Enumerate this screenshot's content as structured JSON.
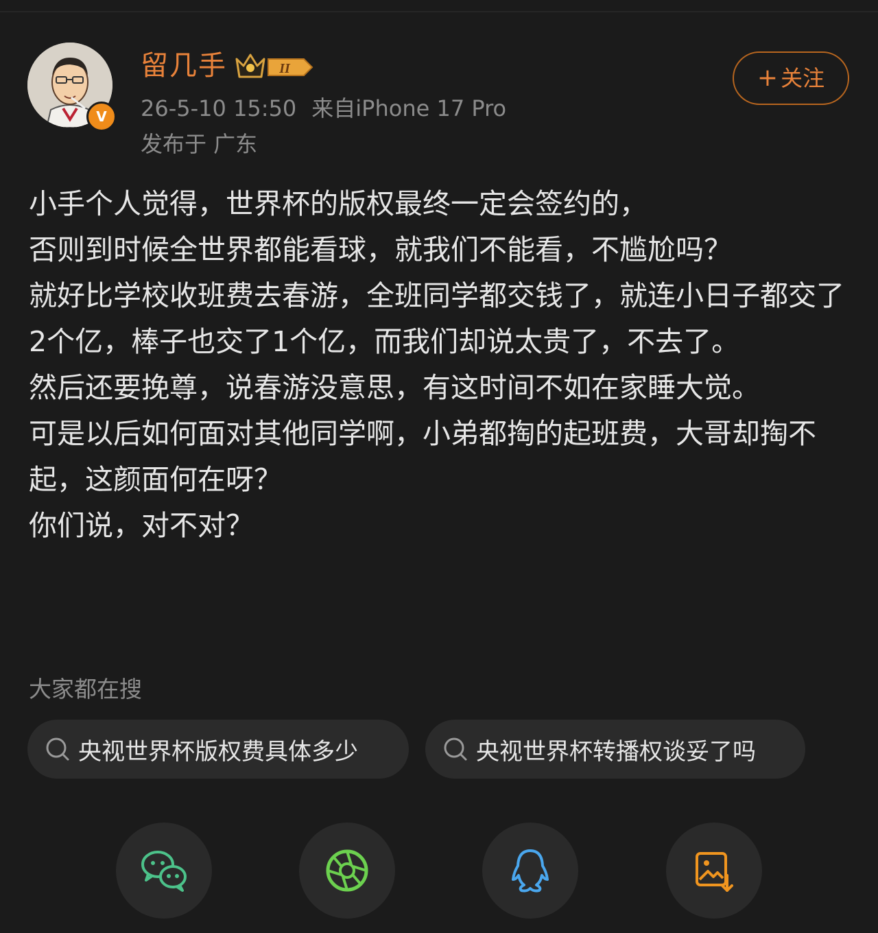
{
  "header": {
    "username": "留几手",
    "level_badge_text": "II",
    "verified_badge": "V",
    "timestamp": "26-5-10 15:50",
    "source": "来自iPhone 17 Pro",
    "location": "发布于 广东",
    "follow_label": "关注",
    "follow_icon": "plus-icon"
  },
  "post": {
    "paragraphs": [
      "小手个人觉得，世界杯的版权最终一定会签约的，",
      "否则到时候全世界都能看球，就我们不能看，不尴尬吗？",
      "就好比学校收班费去春游，全班同学都交钱了，就连小日子都交了2个亿，棒子也交了1个亿，而我们却说太贵了，不去了。",
      "然后还要挽尊，说春游没意思，有这时间不如在家睡大觉。",
      "可是以后如何面对其他同学啊，小弟都掏的起班费，大哥却掏不起，这颜面何在呀？",
      "你们说，对不对？"
    ]
  },
  "search": {
    "heading": "大家都在搜",
    "suggestions": [
      "央视世界杯版权费具体多少",
      "央视世界杯转播权谈妥了吗"
    ]
  },
  "share": {
    "buttons": [
      {
        "name": "wechat",
        "icon": "wechat-icon",
        "color": "#4cc28a"
      },
      {
        "name": "moments",
        "icon": "moments-icon",
        "color": "#6cd14f"
      },
      {
        "name": "qq",
        "icon": "qq-icon",
        "color": "#4aa7ee"
      },
      {
        "name": "save-image",
        "icon": "save-image-icon",
        "color": "#f0951f"
      }
    ]
  },
  "colors": {
    "background": "#1b1b1b",
    "accent": "#e8823a",
    "text": "#e6e6e6",
    "muted": "#8c8c8c",
    "chip": "#2b2b2b"
  }
}
